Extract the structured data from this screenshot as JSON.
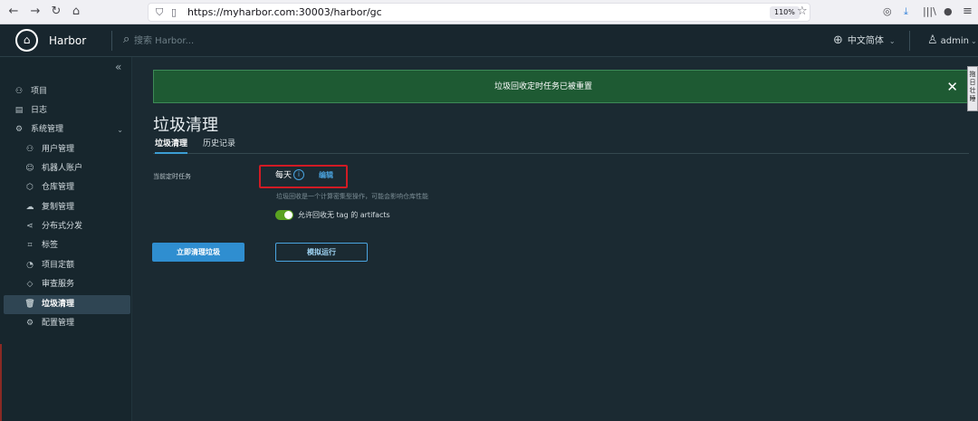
{
  "browser": {
    "back_icon": "←",
    "forward_icon": "→",
    "reload_icon": "↻",
    "home_icon": "⌂",
    "shield_icon": "⛉",
    "page_icon": "▯",
    "url": "https://myharbor.com:30003/harbor/gc",
    "zoom": "110%",
    "bookmark_icon": "☆",
    "pocket_icon": "◎",
    "download_icon": "⤓",
    "library_icon": "|||\\",
    "profile_icon": "●",
    "menu_icon": "≡"
  },
  "header": {
    "logo_glyph": "⌂",
    "brand": "Harbor",
    "search_icon": "⌕",
    "search_placeholder": "搜索 Harbor...",
    "globe_icon": "⊕",
    "language": "中文简体",
    "language_chevron": "⌄",
    "user_icon": "♙",
    "username": "admin",
    "user_chevron": "⌄"
  },
  "sidebar": {
    "collapse_icon": "«",
    "items": [
      {
        "icon": "⚇",
        "label": "项目"
      },
      {
        "icon": "▤",
        "label": "日志"
      },
      {
        "icon": "⚙",
        "label": "系统管理",
        "chevron": "⌄"
      },
      {
        "icon": "⚇",
        "label": "用户管理"
      },
      {
        "icon": "☺",
        "label": "机器人账户"
      },
      {
        "icon": "⬡",
        "label": "仓库管理"
      },
      {
        "icon": "☁",
        "label": "复制管理"
      },
      {
        "icon": "⋖",
        "label": "分布式分发"
      },
      {
        "icon": "⌗",
        "label": "标签"
      },
      {
        "icon": "◔",
        "label": "项目定额"
      },
      {
        "icon": "◇",
        "label": "审查服务"
      },
      {
        "icon": "🗑",
        "label": "垃圾清理"
      },
      {
        "icon": "⚙",
        "label": "配置管理"
      }
    ]
  },
  "alert": {
    "message": "垃圾回收定时任务已被重置",
    "close_icon": "✕"
  },
  "page": {
    "title": "垃圾清理",
    "tabs": [
      "垃圾清理",
      "历史记录"
    ]
  },
  "schedule": {
    "label": "当前定时任务",
    "value": "每天",
    "info_icon": "i",
    "edit_label": "编辑",
    "hint": "垃圾回收是一个计算密集型操作，可能会影响仓库性能"
  },
  "toggle": {
    "label": "允许回收无 tag 的 artifacts",
    "enabled": true
  },
  "actions": {
    "run_now": "立即清理垃圾",
    "dry_run": "模拟运行"
  },
  "side_tab": {
    "text": "拖\n日\n壮\n睡"
  },
  "colors": {
    "accent": "#2f8ed0",
    "link": "#4aa3df",
    "success_bg": "#1e5a33",
    "highlight_box": "#d11b24",
    "toggle_on": "#5aa220"
  }
}
